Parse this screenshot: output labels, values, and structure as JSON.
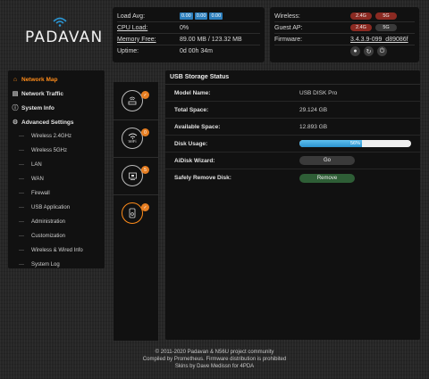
{
  "brand": {
    "name": "PADAVAN"
  },
  "status": {
    "load_avg_label": "Load Avg:",
    "load_avg": [
      "0.00",
      "0.00",
      "0.00"
    ],
    "cpu_label": "CPU Load:",
    "cpu_value": "0%",
    "mem_label": "Memory Free:",
    "mem_value": "89.00 MB / 123.32 MB",
    "uptime_label": "Uptime:",
    "uptime_value": "0d 00h 34m"
  },
  "radio": {
    "wireless_label": "Wireless:",
    "guest_label": "Guest AP:",
    "band_24": "2.4G",
    "band_5": "5G",
    "firmware_label": "Firmware:",
    "firmware_value": "3.4.3.9-099_d89086f"
  },
  "sidebar": {
    "items": [
      {
        "label": "Network Map",
        "icon": "home-icon"
      },
      {
        "label": "Network Traffic",
        "icon": "chart-icon"
      },
      {
        "label": "System Info",
        "icon": "info-icon"
      },
      {
        "label": "Advanced Settings",
        "icon": "gear-icon"
      }
    ],
    "subitems": [
      "Wireless 2.4GHz",
      "Wireless 5GHz",
      "LAN",
      "WAN",
      "Firewall",
      "USB Application",
      "Administration",
      "Customization",
      "Wireless & Wired Info",
      "System Log"
    ]
  },
  "map": {
    "badges": [
      "✓",
      "0",
      "5",
      "✓"
    ],
    "wifi_label": "WiFi"
  },
  "usb": {
    "title": "USB Storage Status",
    "model_label": "Model Name:",
    "model_value": "USB DISK Pro",
    "total_label": "Total Space:",
    "total_value": "29.124 GB",
    "avail_label": "Available Space:",
    "avail_value": "12.893 GB",
    "usage_label": "Disk Usage:",
    "usage_percent": 56,
    "usage_text": "56%",
    "aidisk_label": "AiDisk Wizard:",
    "go_label": "Go",
    "remove_label": "Safely Remove Disk:",
    "remove_button": "Remove"
  },
  "footer": {
    "line1": "© 2011-2020 Padavan & N56U project community",
    "line2": "Compiled by Prometheus. Firmware distribution is prohibited",
    "line3": "Skins by Dave Medissn for 4PDA"
  },
  "colors": {
    "accent": "#ff8c1a",
    "badge_blue": "#2d7fbd",
    "band_on": "#8b2a22",
    "remove_green": "#2e5e36"
  }
}
